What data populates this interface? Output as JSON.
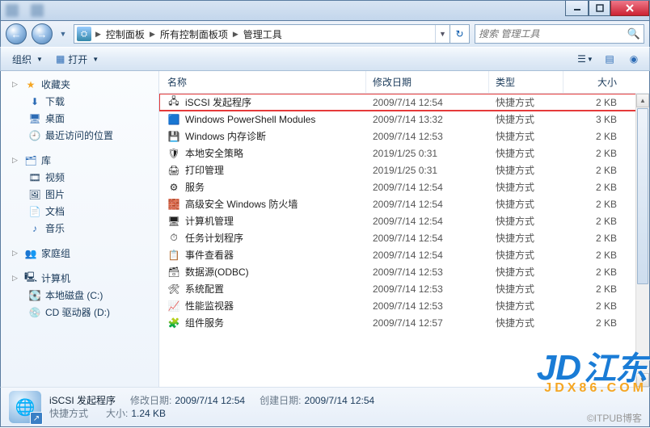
{
  "window": {
    "min": "—",
    "max": "▢",
    "close": "✕"
  },
  "nav_buttons": {
    "back": "←",
    "forward": "→"
  },
  "breadcrumb": [
    "控制面板",
    "所有控制面板项",
    "管理工具"
  ],
  "search": {
    "placeholder": "搜索 管理工具"
  },
  "toolbar": {
    "organize": "组织",
    "open": "打开"
  },
  "columns": {
    "name": "名称",
    "date": "修改日期",
    "type": "类型",
    "size": "大小"
  },
  "rows": [
    {
      "icon": "🖧",
      "name": "iSCSI 发起程序",
      "date": "2009/7/14 12:54",
      "type": "快捷方式",
      "size": "2 KB",
      "selected": true
    },
    {
      "icon": "🟦",
      "name": "Windows PowerShell Modules",
      "date": "2009/7/14 13:32",
      "type": "快捷方式",
      "size": "3 KB"
    },
    {
      "icon": "💾",
      "name": "Windows 内存诊断",
      "date": "2009/7/14 12:53",
      "type": "快捷方式",
      "size": "2 KB"
    },
    {
      "icon": "🛡",
      "name": "本地安全策略",
      "date": "2019/1/25 0:31",
      "type": "快捷方式",
      "size": "2 KB"
    },
    {
      "icon": "🖨",
      "name": "打印管理",
      "date": "2019/1/25 0:31",
      "type": "快捷方式",
      "size": "2 KB"
    },
    {
      "icon": "⚙",
      "name": "服务",
      "date": "2009/7/14 12:54",
      "type": "快捷方式",
      "size": "2 KB"
    },
    {
      "icon": "🧱",
      "name": "高级安全 Windows 防火墙",
      "date": "2009/7/14 12:54",
      "type": "快捷方式",
      "size": "2 KB"
    },
    {
      "icon": "🖥",
      "name": "计算机管理",
      "date": "2009/7/14 12:54",
      "type": "快捷方式",
      "size": "2 KB"
    },
    {
      "icon": "⏱",
      "name": "任务计划程序",
      "date": "2009/7/14 12:54",
      "type": "快捷方式",
      "size": "2 KB"
    },
    {
      "icon": "📋",
      "name": "事件查看器",
      "date": "2009/7/14 12:54",
      "type": "快捷方式",
      "size": "2 KB"
    },
    {
      "icon": "🗃",
      "name": "数据源(ODBC)",
      "date": "2009/7/14 12:53",
      "type": "快捷方式",
      "size": "2 KB"
    },
    {
      "icon": "🛠",
      "name": "系统配置",
      "date": "2009/7/14 12:53",
      "type": "快捷方式",
      "size": "2 KB"
    },
    {
      "icon": "📈",
      "name": "性能监视器",
      "date": "2009/7/14 12:53",
      "type": "快捷方式",
      "size": "2 KB"
    },
    {
      "icon": "🧩",
      "name": "组件服务",
      "date": "2009/7/14 12:57",
      "type": "快捷方式",
      "size": "2 KB"
    }
  ],
  "sidebar": {
    "favorites": {
      "label": "收藏夹",
      "items": [
        "下载",
        "桌面",
        "最近访问的位置"
      ]
    },
    "libraries": {
      "label": "库",
      "items": [
        "视频",
        "图片",
        "文档",
        "音乐"
      ]
    },
    "homegroup": {
      "label": "家庭组"
    },
    "computer": {
      "label": "计算机",
      "items": [
        "本地磁盘 (C:)",
        "CD 驱动器 (D:)"
      ]
    }
  },
  "details": {
    "title": "iSCSI 发起程序",
    "date_label": "修改日期:",
    "date": "2009/7/14 12:54",
    "created_label": "创建日期:",
    "created": "2009/7/14 12:54",
    "type": "快捷方式",
    "size_label": "大小:",
    "size": "1.24 KB"
  },
  "overlay": {
    "logo_a": "JD",
    "logo_b": "江东",
    "sub": "JDX86.COM"
  },
  "footer_caption": "©ITPUB博客"
}
